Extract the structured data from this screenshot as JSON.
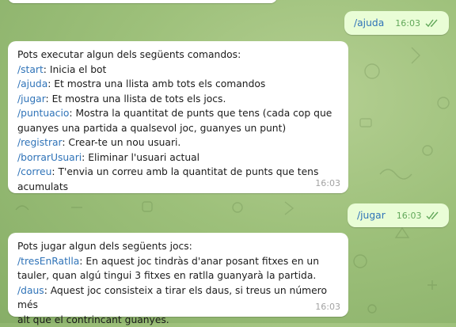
{
  "chat": {
    "outgoing": [
      {
        "text": "/ajuda",
        "time": "16:03"
      },
      {
        "text": "/jugar",
        "time": "16:03"
      }
    ],
    "incoming_help": {
      "intro": "Pots executar algun dels següents comandos:",
      "commands": [
        {
          "cmd": "/start",
          "desc": ": Inicia el bot"
        },
        {
          "cmd": "/ajuda",
          "desc": ": Et mostra una llista amb tots els comandos"
        },
        {
          "cmd": "/jugar",
          "desc": ": Et mostra una llista de tots els jocs."
        },
        {
          "cmd": "/puntuacio",
          "desc": ": Mostra la quantitat de punts que tens (cada cop que",
          "cont": "guanyes una partida a qualsevol joc, guanyes un punt)"
        },
        {
          "cmd": "/registrar",
          "desc": ": Crear-te un nou usuari."
        },
        {
          "cmd": "/borrarUsuari",
          "desc": ": Eliminar l'usuari actual"
        },
        {
          "cmd": "/correu",
          "desc": ": T'envia un correu amb la quantitat de punts que tens",
          "cont": "acumulats"
        }
      ],
      "time": "16:03"
    },
    "incoming_games": {
      "intro": "Pots jugar algun dels següents jocs:",
      "games": [
        {
          "cmd": "/tresEnRatlla",
          "desc": ": En aquest joc tindràs d'anar posant fitxes en un",
          "cont": "tauler, quan algú tingui 3 fitxes en ratlla guanyarà la partida."
        },
        {
          "cmd": "/daus",
          "desc": ": Aquest joc consisteix a tirar els daus, si treus un número més",
          "cont": "alt que el contrincant guanyes."
        }
      ],
      "time": "16:03"
    }
  },
  "colors": {
    "link": "#2f73b8",
    "outgoing_bg": "#e9fdd6",
    "incoming_bg": "#ffffff",
    "read_ticks": "#62a85a"
  },
  "icons": [
    "double-check-icon"
  ]
}
